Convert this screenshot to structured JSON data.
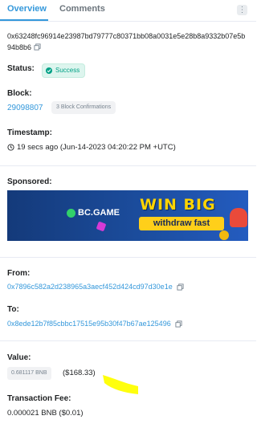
{
  "tabs": {
    "overview": "Overview",
    "comments": "Comments",
    "menu": "⋮"
  },
  "tx": {
    "hash": "0x63248fc96914e23987bd79777c80371bb08a0031e5e28b8a9332b07e5b94b8b6",
    "status_label": "Status:",
    "status_value": "Success",
    "block_label": "Block:",
    "block_number": "29098807",
    "block_confirmations": "3 Block Confirmations",
    "timestamp_label": "Timestamp:",
    "timestamp_value": "19 secs ago (Jun-14-2023 04:20:22 PM +UTC)",
    "sponsored_label": "Sponsored:",
    "from_label": "From:",
    "from_address": "0x7896c582a2d238965a3aecf452d424cd97d30e1e",
    "to_label": "To:",
    "to_address": "0x8ede12b7f85cbbc17515e95b30f47b67ae125496",
    "value_label": "Value:",
    "value_bnb": "0.681117 BNB",
    "value_usd": "($168.33)",
    "fee_label": "Transaction Fee:",
    "fee_value": "0.000021 BNB ($0.01)"
  },
  "ad": {
    "brand": "BC.GAME",
    "headline": "WIN BIG",
    "cta": "withdraw fast"
  },
  "colors": {
    "link": "#3498db",
    "success": "#00a186",
    "highlight": "#ffff00"
  },
  "icons": {
    "copy": "copy-icon",
    "check": "check-icon",
    "clock": "clock-icon",
    "menu": "kebab-menu-icon"
  }
}
